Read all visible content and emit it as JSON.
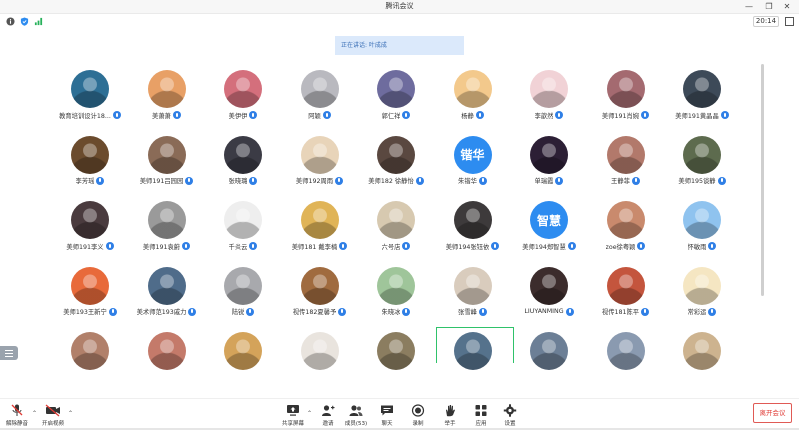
{
  "window": {
    "title": "腾讯会议",
    "clock": "20:14"
  },
  "speaking": {
    "text": "正在讲话: 叶成成"
  },
  "participants": [
    {
      "name": "教育培训设计18...",
      "bg": "#2d6f95"
    },
    {
      "name": "美萧萧",
      "bg": "#e8a066"
    },
    {
      "name": "美伊伊",
      "bg": "#d46f7c"
    },
    {
      "name": "阿颖",
      "bg": "#b9b9bf"
    },
    {
      "name": "郭仁祥",
      "bg": "#6e6c9e"
    },
    {
      "name": "杨静",
      "bg": "#f3c98c"
    },
    {
      "name": "李歆然",
      "bg": "#f1d2d6"
    },
    {
      "name": "美师191肖婉",
      "bg": "#a46a70"
    },
    {
      "name": "美师191黄晶晶",
      "bg": "#3d4a58"
    },
    {
      "name": "李芳瑶",
      "bg": "#6b4b2d"
    },
    {
      "name": "美师191吕园园",
      "bg": "#8a6b57"
    },
    {
      "name": "张晓璐",
      "bg": "#3b3b45"
    },
    {
      "name": "美师192周雨",
      "bg": "#e8d4b9"
    },
    {
      "name": "美师182 徐静怡",
      "bg": "#5a4840"
    },
    {
      "name": "朱锴华",
      "bg": "#2d8cf0",
      "initials": "锴华"
    },
    {
      "name": "单瑞霞",
      "bg": "#2c1f35"
    },
    {
      "name": "王静菲",
      "bg": "#b2796b"
    },
    {
      "name": "美师195谈静",
      "bg": "#5d6b4e"
    },
    {
      "name": "美师191李义",
      "bg": "#4a3b3e"
    },
    {
      "name": "美师191袁蔚",
      "bg": "#9a9a9a"
    },
    {
      "name": "千炎云",
      "bg": "#eeeeee"
    },
    {
      "name": "美师181 戴李楠",
      "bg": "#e0b457"
    },
    {
      "name": "六号店",
      "bg": "#d7c9b0"
    },
    {
      "name": "美师194张钰依",
      "bg": "#3d3a3b"
    },
    {
      "name": "美师194郑智慧",
      "bg": "#2d8cf0",
      "initials": "智慧"
    },
    {
      "name": "zoe徐粤颖",
      "bg": "#c98a6d"
    },
    {
      "name": "怀敏雨",
      "bg": "#8fc3ef"
    },
    {
      "name": "美师193王新宁",
      "bg": "#e86a3a"
    },
    {
      "name": "美术师范193戚力",
      "bg": "#4f6c8a"
    },
    {
      "name": "陆锐",
      "bg": "#a8a9ad"
    },
    {
      "name": "视传182夏馨予",
      "bg": "#a06b3f"
    },
    {
      "name": "朱晓冰",
      "bg": "#9fc59a"
    },
    {
      "name": "张雪峰",
      "bg": "#d9ccbd"
    },
    {
      "name": "LIUYANMING",
      "bg": "#3c2c2c"
    },
    {
      "name": "视传181陈平",
      "bg": "#c4553d"
    },
    {
      "name": "常彩运",
      "bg": "#f5e6c2"
    },
    {
      "name": "",
      "bg": "#b1806a"
    },
    {
      "name": "",
      "bg": "#c47a6a"
    },
    {
      "name": "",
      "bg": "#d4a35a"
    },
    {
      "name": "",
      "bg": "#e9e4de"
    },
    {
      "name": "",
      "bg": "#8b7d60"
    },
    {
      "name": "",
      "bg": "#55728c"
    },
    {
      "name": "",
      "bg": "#6c7f96"
    },
    {
      "name": "",
      "bg": "#8a9ab0"
    },
    {
      "name": "",
      "bg": "#cdb38f"
    }
  ],
  "toolbar": {
    "mute": "解除静音",
    "video": "开启视频",
    "share": "共享屏幕",
    "invite": "邀请",
    "members": "成员(53)",
    "chat": "聊天",
    "record": "录制",
    "raise_hand": "举手",
    "apps": "应用",
    "settings": "设置",
    "leave": "离开会议"
  },
  "colors": {
    "accent": "#2d8cf0",
    "leave": "#e03c36",
    "banner": "#dbe9fb"
  }
}
